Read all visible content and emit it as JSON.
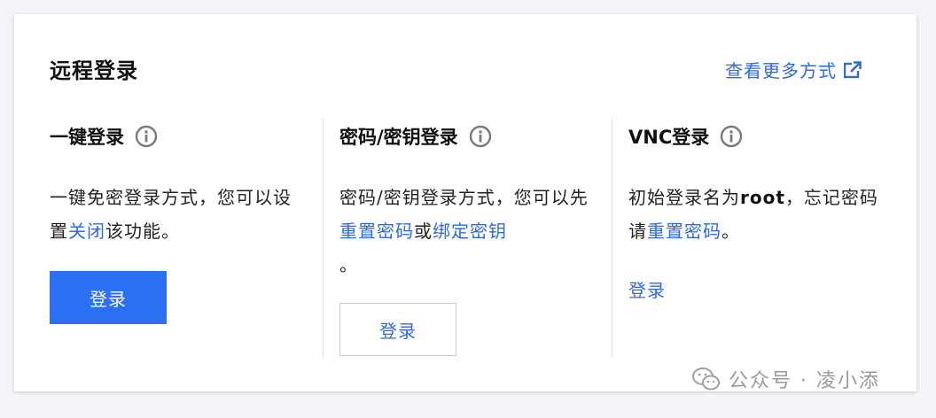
{
  "header": {
    "title": "远程登录",
    "more_link": "查看更多方式"
  },
  "columns": [
    {
      "title": "一键登录",
      "desc_before": "一键免密登录方式，您可以设置",
      "desc_link": "关闭",
      "desc_after": "该功能。",
      "button_label": "登录"
    },
    {
      "title": "密码/密钥登录",
      "desc_before": "密码/密钥登录方式，您可以先 ",
      "desc_link1": "重置密码",
      "desc_mid": "或",
      "desc_link2": "绑定密钥",
      "desc_after": "。",
      "button_label": "登录"
    },
    {
      "title": "VNC登录",
      "desc_before": "初始登录名为",
      "desc_bold": "root",
      "desc_mid": "，忘记密码请",
      "desc_link": "重置密码",
      "desc_after": "。",
      "link_label": "登录"
    }
  ],
  "watermark": {
    "text": "公众号 · 凌小添"
  },
  "colors": {
    "link": "#2f6bd6",
    "primary_button": "#2b6ff2"
  },
  "icons": {
    "external": "external-link-icon",
    "info": "info-icon",
    "watermark": "wechat-icon"
  }
}
